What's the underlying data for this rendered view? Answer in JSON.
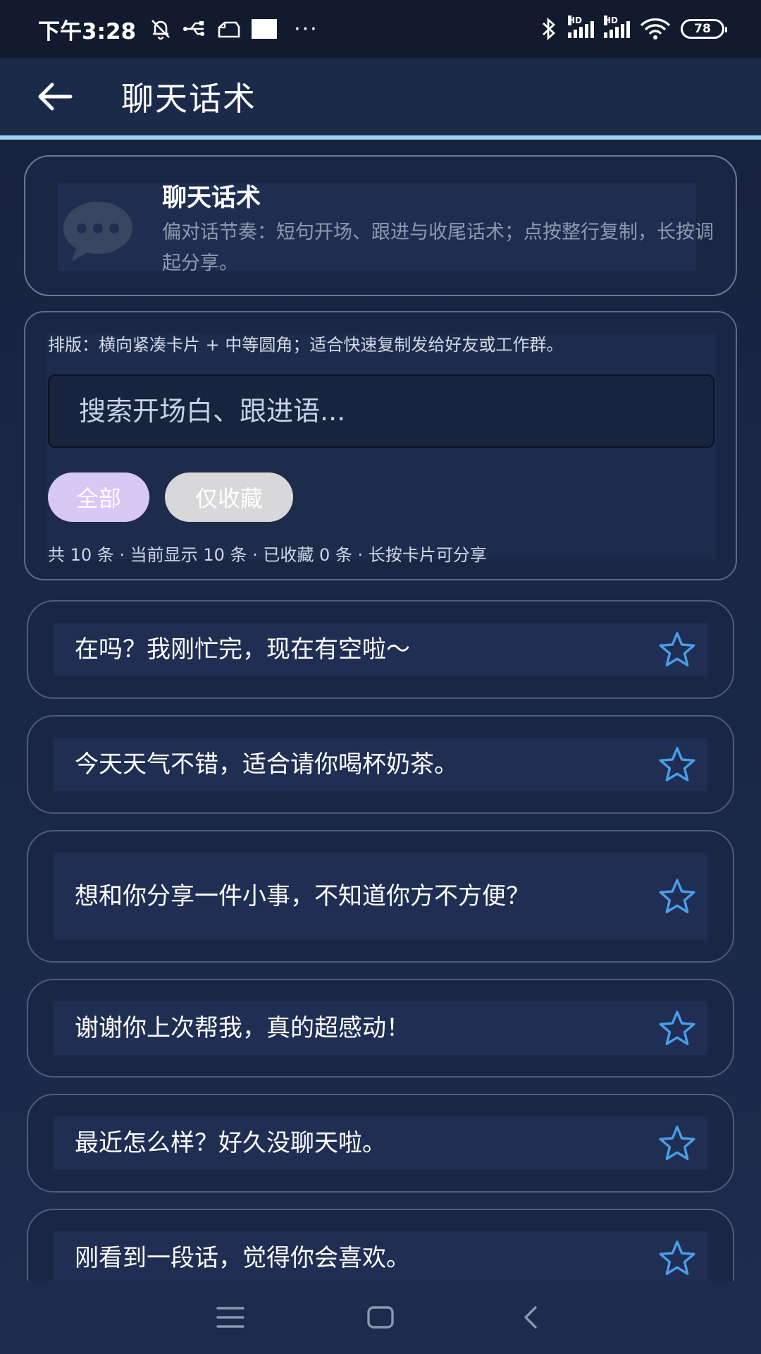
{
  "status_bar": {
    "time": "下午3:28",
    "more": "···",
    "hd1": "HD",
    "hd2": "HD",
    "battery": "78",
    "icons": [
      "mute-bell-icon",
      "usb-icon",
      "cloud-icon",
      "bluetooth-icon",
      "signal-icon",
      "wifi-icon",
      "battery-icon"
    ]
  },
  "app_bar": {
    "title": "聊天话术",
    "back_icon": "arrow-left-icon"
  },
  "header": {
    "title": "聊天话术",
    "description": "偏对话节奏：短句开场、跟进与收尾话术；点按整行复制，长按调起分享。",
    "icon": "chat-bubble-icon"
  },
  "controls": {
    "layout_note": "排版：横向紧凑卡片 + 中等圆角；适合快速复制发给好友或工作群。",
    "search_placeholder": "搜索开场白、跟进语...",
    "filters": [
      {
        "label": "全部",
        "selected": true
      },
      {
        "label": "仅收藏",
        "selected": false
      }
    ],
    "stats": "共 10 条 · 当前显示 10 条 · 已收藏 0 条 · 长按卡片可分享"
  },
  "phrases": [
    {
      "text": "在吗？我刚忙完，现在有空啦～",
      "favorited": false
    },
    {
      "text": "今天天气不错，适合请你喝杯奶茶。",
      "favorited": false
    },
    {
      "text": "想和你分享一件小事，不知道你方不方便？",
      "favorited": false
    },
    {
      "text": "谢谢你上次帮我，真的超感动！",
      "favorited": false
    },
    {
      "text": "最近怎么样？好久没聊天啦。",
      "favorited": false
    },
    {
      "text": "刚看到一段话，觉得你会喜欢。",
      "favorited": false
    }
  ],
  "colors": {
    "accent_line": "#9fd0f5",
    "star": "#4a9eea",
    "chip_selected": "#d8c8f4",
    "chip_unselected": "#d8d8da"
  },
  "nav_bar": {
    "icons": [
      "menu-icon",
      "home-icon",
      "back-icon"
    ]
  }
}
